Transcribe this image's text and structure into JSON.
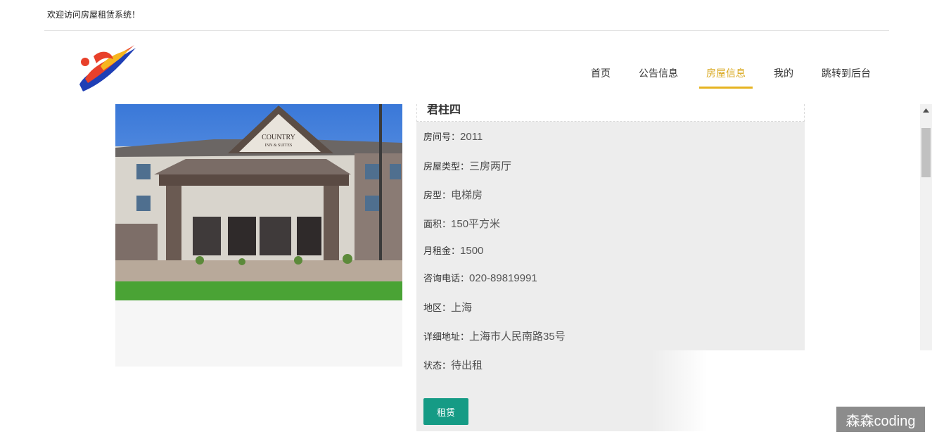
{
  "topbar": {
    "welcome": "欢迎访问房屋租赁系统！"
  },
  "nav": {
    "items": [
      {
        "label": "首页",
        "active": false
      },
      {
        "label": "公告信息",
        "active": false
      },
      {
        "label": "房屋信息",
        "active": true
      },
      {
        "label": "我的",
        "active": false
      },
      {
        "label": "跳转到后台",
        "active": false
      }
    ]
  },
  "house": {
    "name": "君柱四",
    "fields": [
      {
        "label": "房间号：",
        "value": "2011"
      },
      {
        "label": "房屋类型：",
        "value": "三房两厅"
      },
      {
        "label": "房型：",
        "value": "电梯房"
      },
      {
        "label": "面积：",
        "value": "150平方米"
      },
      {
        "label": "月租金：",
        "value": "1500"
      },
      {
        "label": "咨询电话：",
        "value": "020-89819991"
      },
      {
        "label": "地区：",
        "value": "上海"
      },
      {
        "label": "详细地址：",
        "value": "上海市人民南路35号"
      },
      {
        "label": "状态：",
        "value": "待出租"
      }
    ],
    "rent_button": "租赁",
    "photo_sign": "COUNTRY INN & SUITES"
  },
  "watermark": "森森coding",
  "colors": {
    "accent": "#e6b422",
    "button": "#159b85",
    "panel": "#ededed"
  }
}
